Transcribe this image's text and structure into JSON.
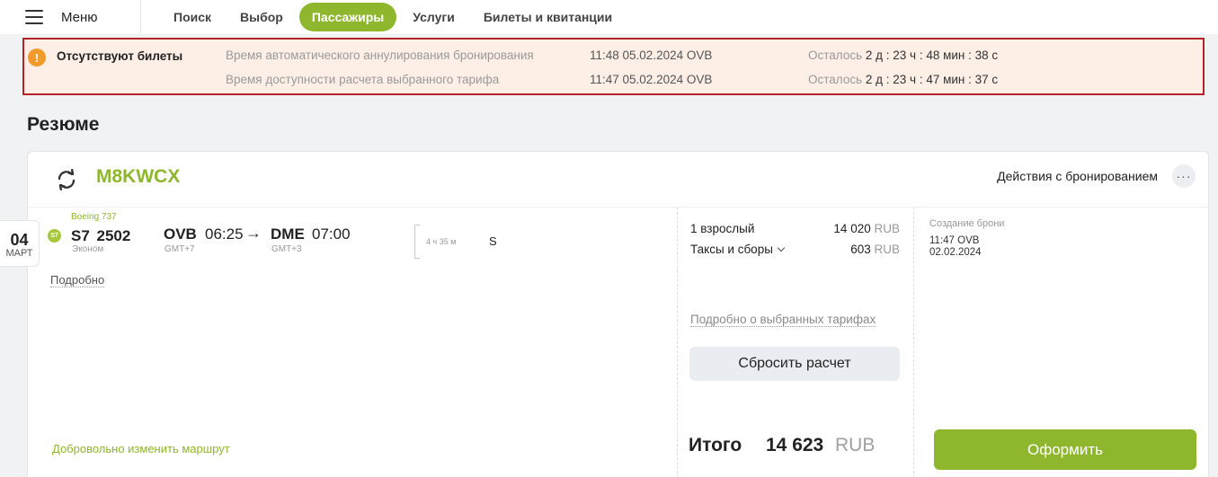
{
  "nav": {
    "menu_label": "Меню",
    "tabs": [
      "Поиск",
      "Выбор",
      "Пассажиры",
      "Услуги",
      "Билеты и квитанции"
    ],
    "active_tab": "Пассажиры"
  },
  "alert": {
    "title": "Отсутствуют билеты",
    "rows": [
      {
        "label": "Время автоматического аннулирования бронирования",
        "time": "11:48 05.02.2024 OVB",
        "remain_prefix": "Осталось",
        "remain": "2 д : 23 ч : 48 мин : 38 с"
      },
      {
        "label": "Время доступности расчета выбранного тарифа",
        "time": "11:47 05.02.2024 OVB",
        "remain_prefix": "Осталось",
        "remain": "2 д : 23 ч : 47 мин : 37 с"
      }
    ]
  },
  "summary": {
    "title": "Резюме",
    "pnr": "M8KWCX",
    "actions_label": "Действия с бронированием",
    "more_label": "···"
  },
  "flight": {
    "date_day": "04",
    "date_month": "МАРТ",
    "aircraft": "Boeing 737",
    "airline_logo_text": "S7",
    "flight_number": "S7 2502",
    "cabin": "Эконом",
    "dep_code": "OVB",
    "dep_time": "06:25",
    "dep_tz": "GMT+7",
    "arrow": "→",
    "arr_code": "DME",
    "arr_time": "07:00",
    "arr_tz": "GMT+3",
    "duration": "4 ч 35 м",
    "fare_class": "S",
    "details_link": "Подробно",
    "reroute_link": "Добровольно изменить маршрут"
  },
  "pricing": {
    "adult_label": "1 взрослый",
    "adult_amount": "14 020",
    "taxes_label": "Таксы и сборы",
    "taxes_amount": "603",
    "currency": "RUB",
    "tariffs_link": "Подробно о выбранных тарифах",
    "reset_button": "Сбросить расчет",
    "total_label": "Итого",
    "total_amount": "14 623",
    "total_currency": "RUB"
  },
  "booking": {
    "created_label": "Создание брони",
    "created_time": "11:47 OVB",
    "created_date": "02.02.2024",
    "checkout_button": "Оформить"
  },
  "colors": {
    "accent": "#8fb72e",
    "alert_border": "#b3242a",
    "alert_bg": "#fdeee6",
    "warning": "#f29a2e"
  }
}
